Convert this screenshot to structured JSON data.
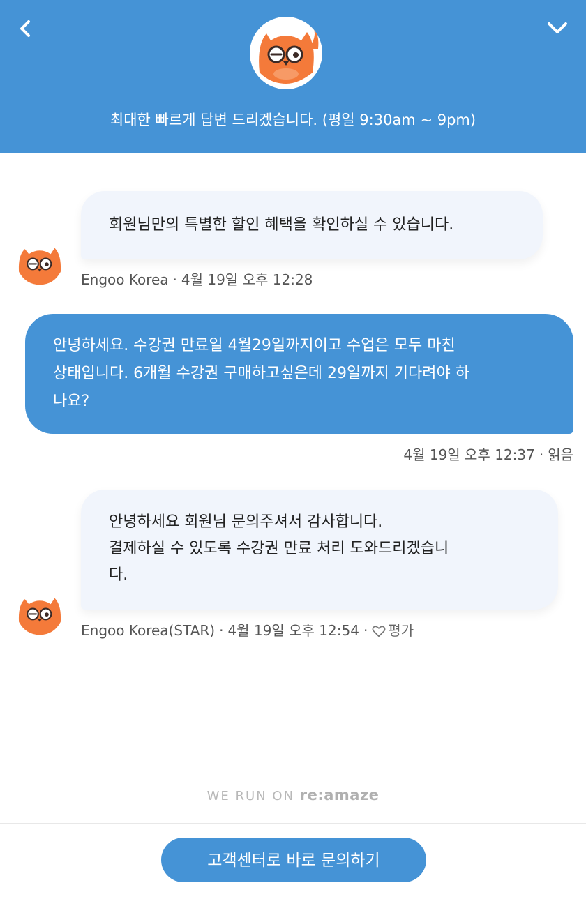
{
  "header": {
    "subtitle": "최대한 빠르게 답변 드리겠습니다. (평일 9:30am ~ 9pm)"
  },
  "messages": [
    {
      "sender": "agent",
      "lines": [
        "회원님만의 특별한 할인 혜택을 확인하실 수 있습니다."
      ],
      "author": "Engoo Korea",
      "time": "4월 19일 오후 12:28"
    },
    {
      "sender": "user",
      "lines": [
        "안녕하세요. 수강권 만료일 4월29일까지이고 수업은 모두 마친",
        "상태입니다. 6개월 수강권 구매하고싶은데 29일까지 기다려야 하",
        "나요?"
      ],
      "time": "4월 19일 오후 12:37",
      "status": "읽음"
    },
    {
      "sender": "agent",
      "lines": [
        "안녕하세요 회원님 문의주셔서 감사합니다.",
        "결제하실 수 있도록 수강권 만료 처리 도와드리겠습니",
        "다."
      ],
      "author": "Engoo Korea(STAR)",
      "time": "4월 19일 오후 12:54",
      "rate_label": "평가"
    }
  ],
  "powered_by": {
    "prefix": "WE RUN ON",
    "brand": "re:amaze"
  },
  "footer": {
    "cta_label": "고객센터로 바로 문의하기"
  },
  "colors": {
    "primary": "#4593d6",
    "agent_bubble": "#f1f5fc",
    "mascot": "#f47a3a"
  }
}
